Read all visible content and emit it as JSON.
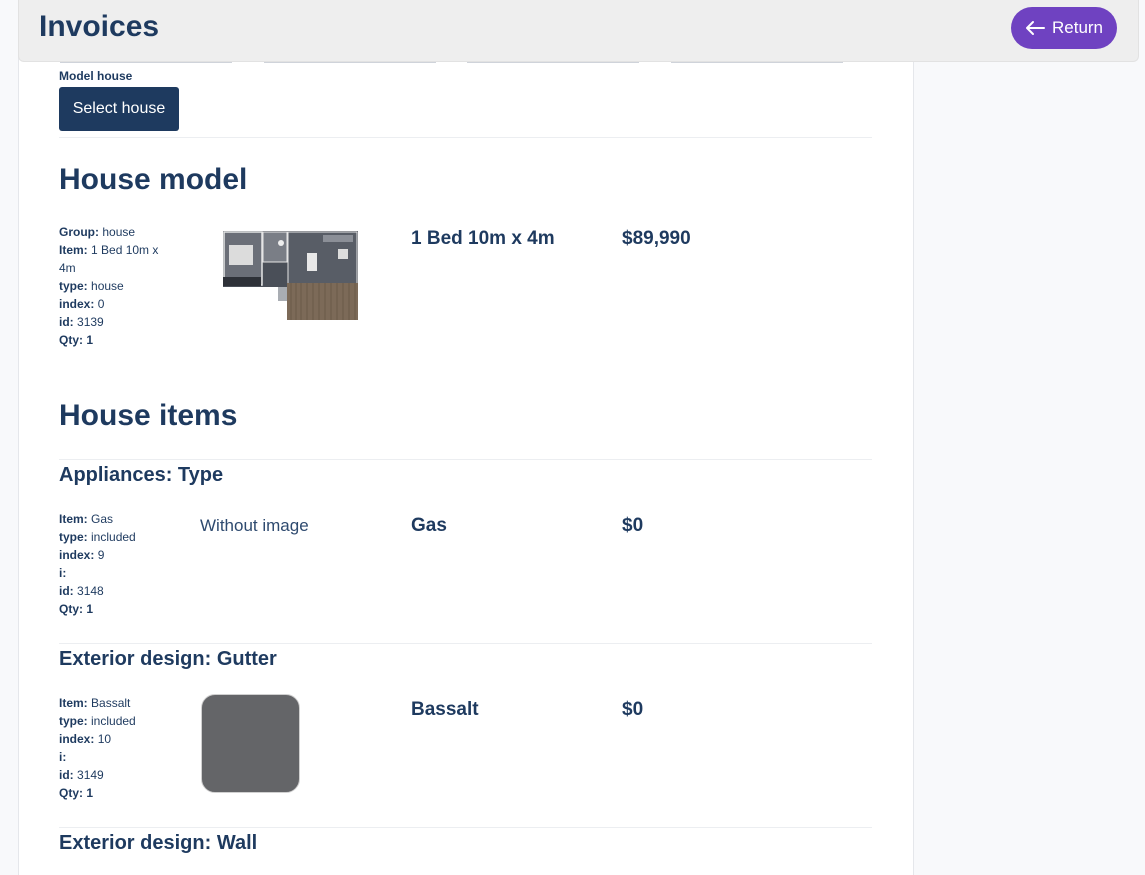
{
  "header": {
    "title": "Invoices",
    "return_label": "Return"
  },
  "model_select": {
    "label": "Model house",
    "button_label": "Select house"
  },
  "house_model": {
    "heading": "House model",
    "meta": [
      {
        "key": "Group:",
        "value": "house"
      },
      {
        "key": "Item:",
        "value": "1 Bed 10m x 4m"
      },
      {
        "key": "type:",
        "value": "house"
      },
      {
        "key": "index:",
        "value": "0"
      },
      {
        "key": "id:",
        "value": "3139"
      },
      {
        "key": "Qty:",
        "value": "1"
      }
    ],
    "name": "1 Bed 10m x 4m",
    "price": "$89,990"
  },
  "house_items": {
    "heading": "House items",
    "items": [
      {
        "title": "Appliances: Type",
        "meta": [
          {
            "key": "Item:",
            "value": "Gas"
          },
          {
            "key": "type:",
            "value": "included"
          },
          {
            "key": "index:",
            "value": "9"
          },
          {
            "key": "i:",
            "value": ""
          },
          {
            "key": "id:",
            "value": "3148"
          },
          {
            "key": "Qty:",
            "value": "1"
          }
        ],
        "image_placeholder": "Without image",
        "name": "Gas",
        "price": "$0"
      },
      {
        "title": "Exterior design: Gutter",
        "meta": [
          {
            "key": "Item:",
            "value": "Bassalt"
          },
          {
            "key": "type:",
            "value": "included"
          },
          {
            "key": "index:",
            "value": "10"
          },
          {
            "key": "i:",
            "value": ""
          },
          {
            "key": "id:",
            "value": "3149"
          },
          {
            "key": "Qty:",
            "value": "1"
          }
        ],
        "swatch_color": "#646568",
        "name": "Bassalt",
        "price": "$0"
      },
      {
        "title": "Exterior design: Wall"
      }
    ]
  },
  "colors": {
    "primary": "#1e3a5f",
    "accent": "#6f42c1",
    "header_bg": "#eeeeee"
  },
  "icons": {
    "return": "arrow-left-icon",
    "house_image": "floorplan-image"
  }
}
